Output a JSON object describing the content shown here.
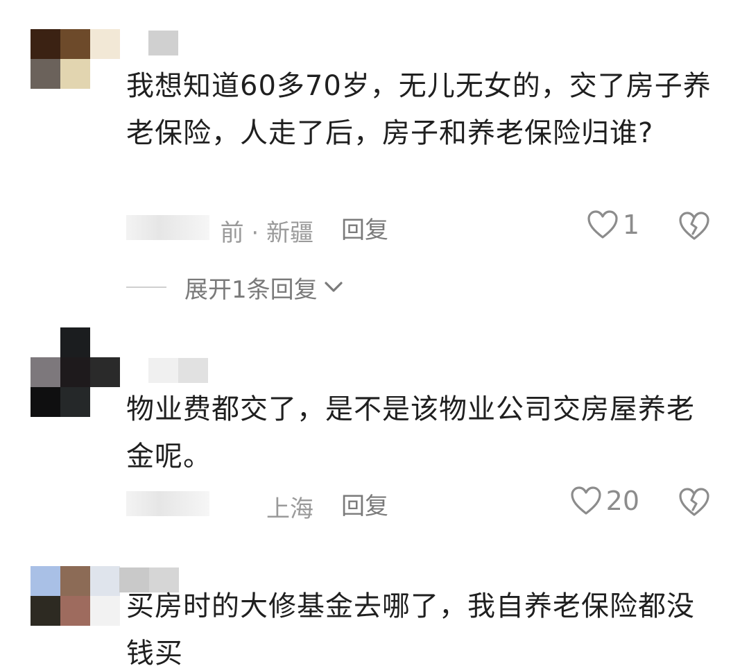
{
  "comments": [
    {
      "avatar": {
        "pixels": [
          "#3b2213",
          "#6d4a2a",
          "#f2e8d6",
          "#6b625b",
          "#e2d5b0",
          "#ffffff"
        ]
      },
      "username_pixels": [
        "#d0d0d0",
        "#ffffff"
      ],
      "text": "我想知道60多70岁，无儿无女的，交了房子养老保险，人走了后，房子和养老保险归谁?",
      "location": "前 · 新疆",
      "reply_label": "回复",
      "like_count": "1",
      "expand_label": "展开1条回复"
    },
    {
      "avatar": {
        "pixels": [
          "#ffffff",
          "#1b1d1f",
          "#ffffff",
          "#7d787c",
          "#1e1a1c",
          "#2a2a2a",
          "#0f0f10",
          "#252829",
          "#ffffff"
        ]
      },
      "username_pixels": [
        "#f0f0f0",
        "#e1e1e1"
      ],
      "text": "物业费都交了，是不是该物业公司交房屋养老金呢。",
      "location": "上海",
      "reply_label": "回复",
      "like_count": "20"
    },
    {
      "avatar": {
        "pixels": [
          "#a9c0e6",
          "#8c6b56",
          "#dfe4ec",
          "#2d2a22",
          "#9e6b5e",
          "#f2f2f2"
        ]
      },
      "username_pixels": [
        "#c9c9c9",
        "#d6d6d6"
      ],
      "text": "买房时的大修基金去哪了，我自养老保险都没钱买"
    }
  ],
  "colors": {
    "text": "#1f1f1f",
    "meta": "#9a9a9a",
    "icon": "#8c8c8c"
  },
  "icons": {
    "like": "heart-outline-icon",
    "dislike": "broken-heart-icon",
    "expand": "chevron-down-icon"
  }
}
